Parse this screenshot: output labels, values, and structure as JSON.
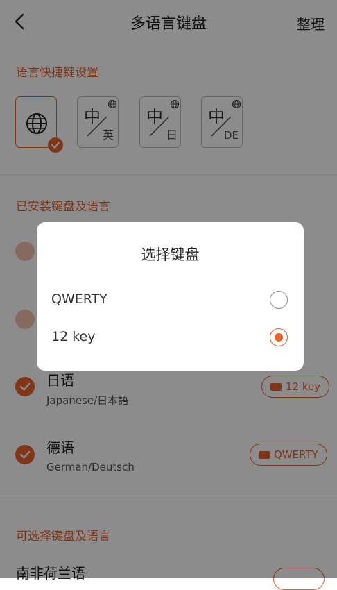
{
  "header": {
    "title": "多语言键盘",
    "organize_label": "整理"
  },
  "shortcut_section": {
    "title": "语言快捷键设置",
    "tiles": [
      {
        "icon": "globe-icon",
        "main": "",
        "secondary": "",
        "selected": true
      },
      {
        "icon": "globe-icon",
        "main": "中",
        "secondary": "英",
        "selected": false
      },
      {
        "icon": "globe-icon",
        "main": "中",
        "secondary": "日",
        "selected": false
      },
      {
        "icon": "globe-icon",
        "main": "中",
        "secondary": "DE",
        "selected": false
      }
    ]
  },
  "installed_section": {
    "title": "已安装键盘及语言",
    "items": [
      {
        "title": "日语",
        "subtitle": "Japanese/日本語",
        "keyboard": "12 key",
        "checked": true
      },
      {
        "title": "德语",
        "subtitle": "German/Deutsch",
        "keyboard": "QWERTY",
        "checked": true
      }
    ]
  },
  "available_section": {
    "title": "可选择键盘及语言",
    "items": [
      {
        "title": "南非荷兰语"
      }
    ]
  },
  "dialog": {
    "title": "选择键盘",
    "options": [
      {
        "label": "QWERTY",
        "selected": false
      },
      {
        "label": "12 key",
        "selected": true
      }
    ]
  },
  "colors": {
    "accent": "#e8622c",
    "overlay": "rgba(0,0,0,0.45)"
  }
}
